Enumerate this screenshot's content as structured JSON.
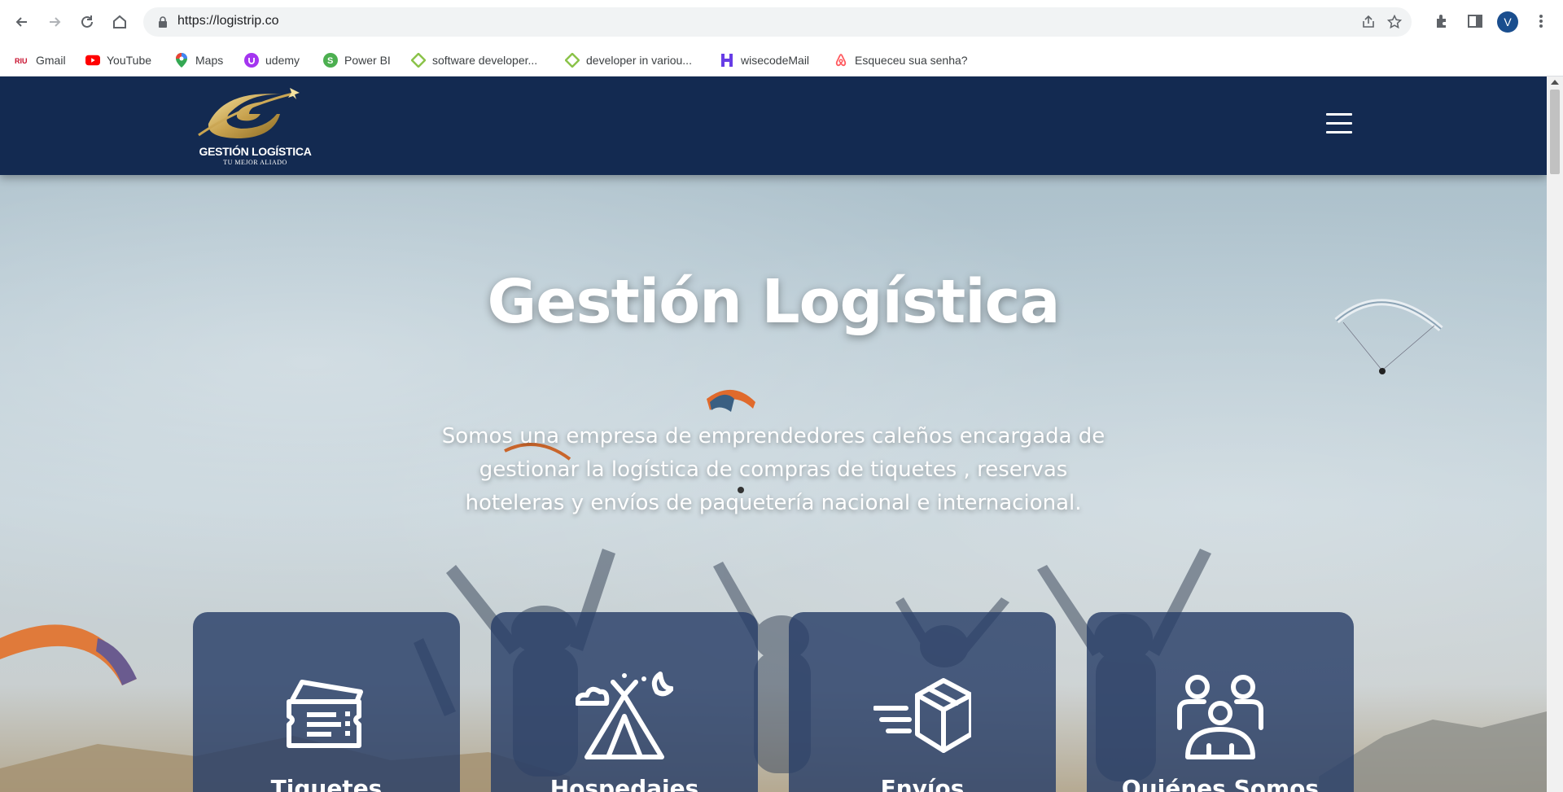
{
  "browser": {
    "url": "https://logistrip.co",
    "profile_initial": "V",
    "bookmarks": [
      {
        "label": "Gmail",
        "icon": "riu-icon"
      },
      {
        "label": "YouTube",
        "icon": "youtube-icon"
      },
      {
        "label": "Maps",
        "icon": "maps-icon"
      },
      {
        "label": "udemy",
        "icon": "udemy-icon"
      },
      {
        "label": "Power BI",
        "icon": "powerbi-icon"
      },
      {
        "label": "software developer...",
        "icon": "diamond-icon"
      },
      {
        "label": "developer in variou...",
        "icon": "diamond-icon"
      },
      {
        "label": "wisecodeMail",
        "icon": "h-logo-icon"
      },
      {
        "label": "Esqueceu sua senha?",
        "icon": "airbnb-icon"
      }
    ]
  },
  "site": {
    "logo_name": "GESTIÓN LOGÍSTICA",
    "logo_tagline": "TU MEJOR ALIADO",
    "hero_title": "Gestión Logística",
    "hero_lines": [
      "Somos una empresa de emprendedores caleños encargada de",
      "gestionar la logística de compras de tiquetes , reservas",
      "hoteleras y envíos de paquetería nacional e internacional."
    ],
    "cards": [
      {
        "label": "Tiquetes",
        "icon": "ticket-icon"
      },
      {
        "label": "Hospedajes",
        "icon": "tent-icon"
      },
      {
        "label": "Envíos",
        "icon": "shipping-box-icon"
      },
      {
        "label": "Quiénes Somos",
        "icon": "team-icon"
      }
    ],
    "colors": {
      "header": "#132a51",
      "card": "#283e68",
      "text": "#ffffff"
    }
  }
}
